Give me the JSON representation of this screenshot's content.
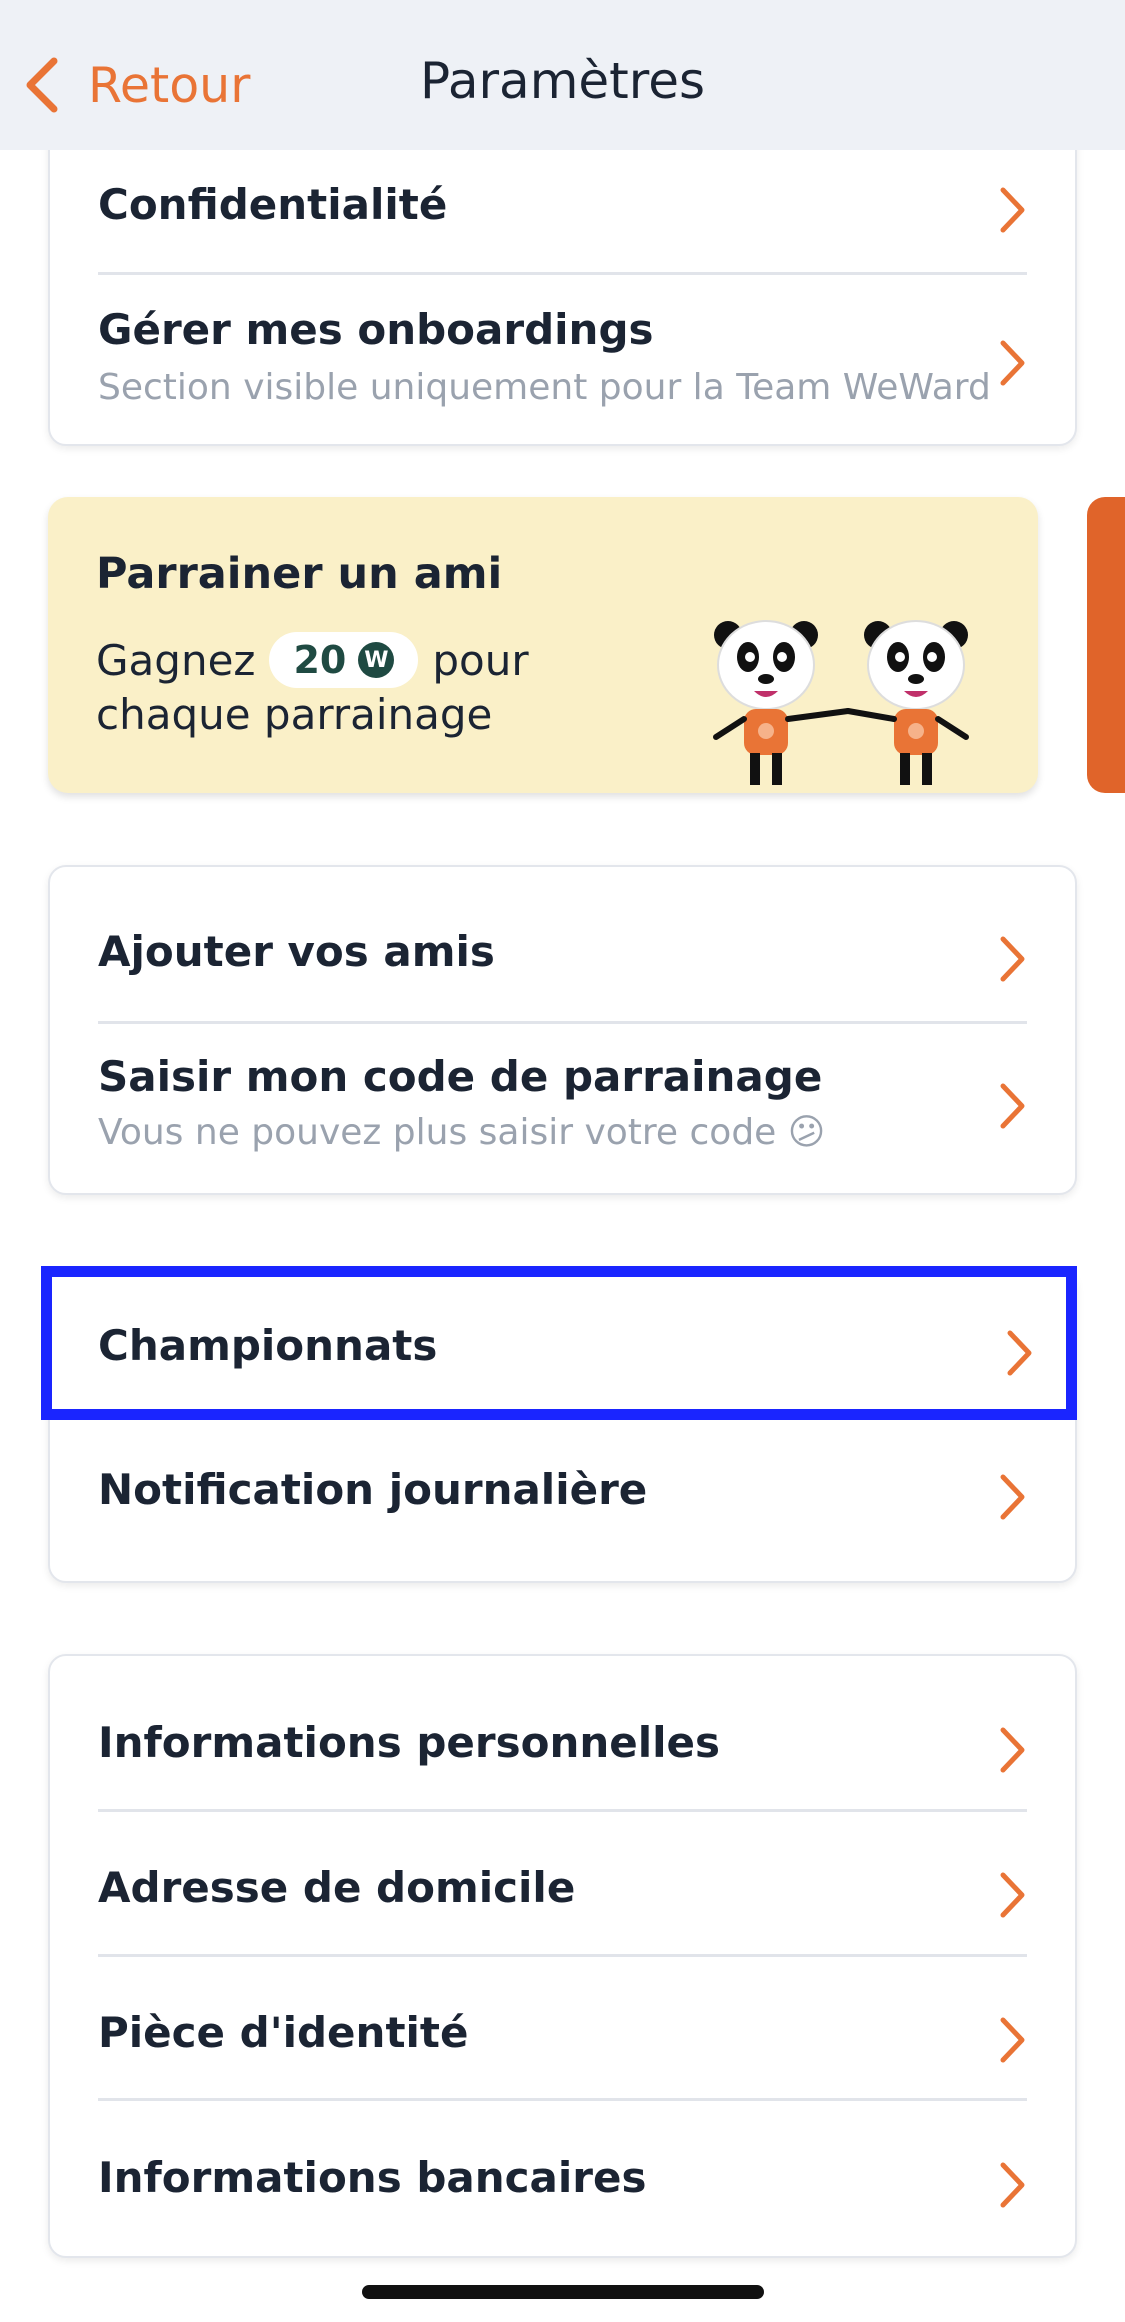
{
  "header": {
    "back_label": "Retour",
    "title": "Paramètres"
  },
  "group1": {
    "items": [
      {
        "label": "Confidentialité"
      },
      {
        "label": "Gérer mes onboardings",
        "sub": "Section visible uniquement pour la Team WeWard"
      }
    ]
  },
  "referral": {
    "title": "Parrainer un ami",
    "gain_prefix": "Gagnez",
    "amount": "20",
    "coin_symbol": "W",
    "gain_suffix": "pour",
    "line2": "chaque parrainage"
  },
  "group2": {
    "items": [
      {
        "label": "Ajouter vos amis"
      },
      {
        "label": "Saisir mon code de parrainage",
        "sub": "Vous ne pouvez plus saisir votre code 😕"
      }
    ]
  },
  "group3": {
    "items": [
      {
        "label": "Championnats"
      },
      {
        "label": "Notification journalière"
      }
    ]
  },
  "group4": {
    "items": [
      {
        "label": "Informations personnelles"
      },
      {
        "label": "Adresse de domicile"
      },
      {
        "label": "Pièce d'identité"
      },
      {
        "label": "Informations bancaires"
      }
    ]
  },
  "colors": {
    "accent": "#e97436",
    "highlight": "#1a25ff",
    "referral_bg": "#faf0c8"
  }
}
